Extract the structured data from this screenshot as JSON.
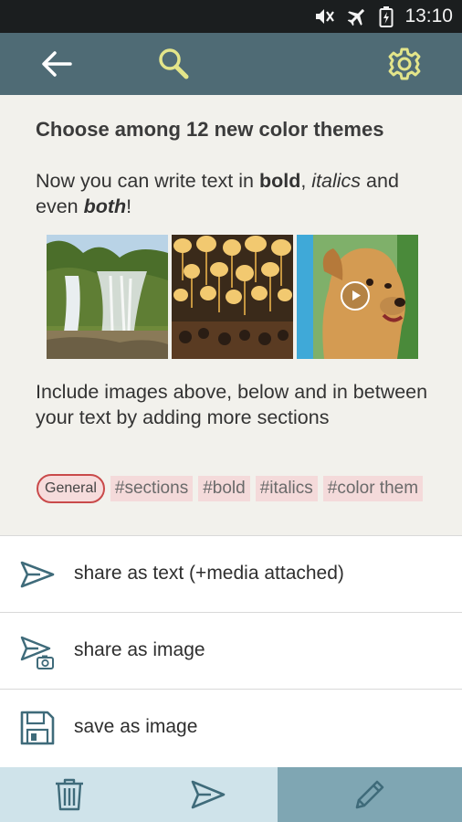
{
  "status_bar": {
    "time": "13:10",
    "icons": [
      "mute-icon",
      "airplane-mode-icon",
      "battery-icon"
    ]
  },
  "toolbar": {
    "back_icon": "arrow-left-icon",
    "search_icon": "search-icon",
    "settings_icon": "gear-icon"
  },
  "content": {
    "title": "Choose among 12 new color themes",
    "para1": {
      "t1": "Now you can write text in ",
      "bold": "bold",
      "t2": ", ",
      "italics": "italics",
      "t3": " and even ",
      "both": "both",
      "t4": "!"
    },
    "images": [
      {
        "name": "waterfall-image"
      },
      {
        "name": "lanterns-image"
      },
      {
        "name": "dog-video-thumbnail",
        "has_play": true
      }
    ],
    "para2": "Include images above, below and in between your text by adding more sections",
    "tags": {
      "primary": "General",
      "items": [
        "#sections",
        "#bold",
        "#italics",
        "#color them"
      ]
    }
  },
  "actions": [
    {
      "label": "share as text (+media attached)",
      "icon": "send-icon"
    },
    {
      "label": "share as image",
      "icon": "send-camera-icon"
    },
    {
      "label": "save as image",
      "icon": "floppy-disk-icon"
    }
  ],
  "bottom_bar": {
    "items": [
      "trash-icon",
      "send-icon",
      "pencil-icon"
    ],
    "active": "pencil-icon"
  },
  "colors": {
    "toolbar": "#4f6b75",
    "accent_icon": "#e3e58a",
    "background": "#f2f1ec",
    "tag_border": "#c94a4a",
    "tag_bg": "#f4dada",
    "icon_stroke": "#3f6b7a",
    "bottom_left_bg": "#cfe3ea",
    "bottom_right_bg": "#7fa6b3"
  }
}
